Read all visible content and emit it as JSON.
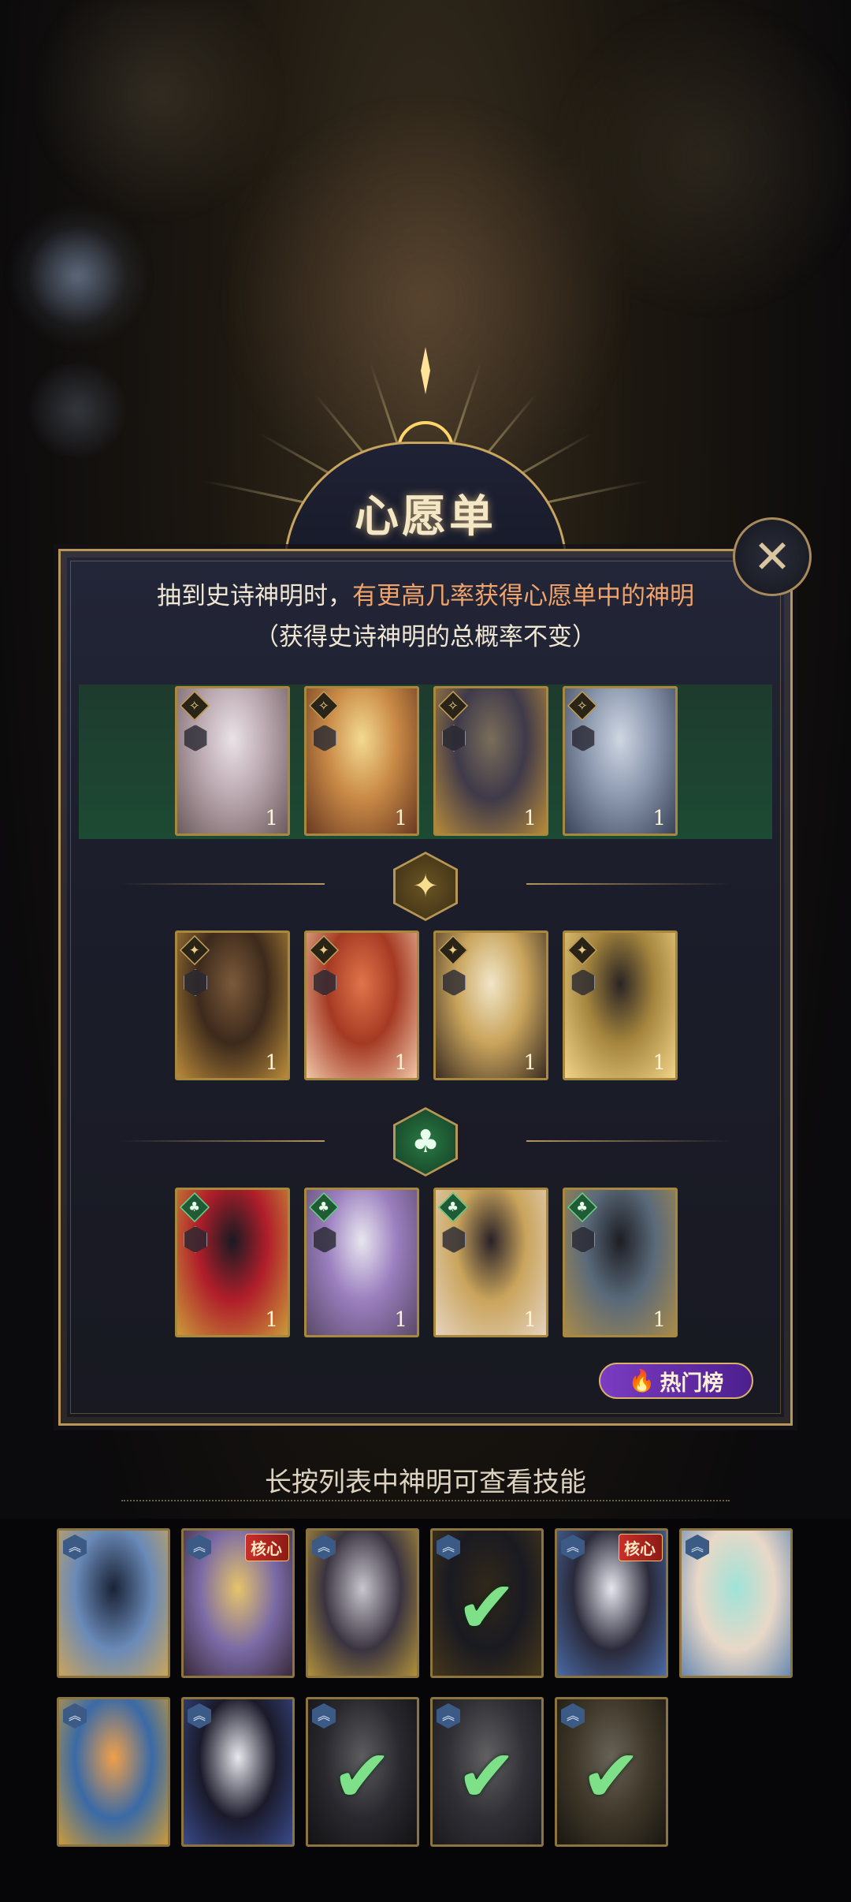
{
  "wishlist": {
    "title": "心愿单",
    "desc_prefix": "抽到史诗神明时，",
    "desc_highlight": "有更高几率获得心愿单中的神明",
    "desc_note": "（获得史诗神明的总概率不变）",
    "close_icon": "close-x-icon",
    "hot_list_label": "热门榜",
    "hot_list_icon": "flame-icon"
  },
  "rows": [
    {
      "group": "top",
      "cards": [
        {
          "count": "1",
          "palette": [
            "#e9e2e6",
            "#b9a7ae",
            "#6c5b5e"
          ]
        },
        {
          "count": "1",
          "palette": [
            "#f3d990",
            "#c98a46",
            "#6a3a22"
          ]
        },
        {
          "count": "1",
          "palette": [
            "#7a6e5a",
            "#3f3a4a",
            "#b78a3a"
          ]
        },
        {
          "count": "1",
          "palette": [
            "#cfd6e3",
            "#8a97ad",
            "#3b4459"
          ]
        }
      ]
    },
    {
      "group": "star",
      "divider_icon": "four-point-star-icon",
      "cards": [
        {
          "count": "1",
          "palette": [
            "#7b5a3a",
            "#3d2a1c",
            "#b98a3a"
          ]
        },
        {
          "count": "1",
          "palette": [
            "#e0744a",
            "#a53a24",
            "#f0c6a8"
          ]
        },
        {
          "count": "1",
          "palette": [
            "#f1e6c8",
            "#c9a45c",
            "#3a2c22"
          ]
        },
        {
          "count": "1",
          "palette": [
            "#2a2424",
            "#a6863e",
            "#f0d48a"
          ]
        }
      ]
    },
    {
      "group": "club",
      "divider_icon": "club-suit-icon",
      "cards": [
        {
          "count": "1",
          "palette": [
            "#1a1a22",
            "#b01e2a",
            "#c99a3a"
          ]
        },
        {
          "count": "1",
          "palette": [
            "#e8e6ef",
            "#9b7fbf",
            "#5a4a6a"
          ]
        },
        {
          "count": "1",
          "palette": [
            "#2a2228",
            "#c9a45c",
            "#e5d3c0"
          ]
        },
        {
          "count": "1",
          "palette": [
            "#1e1e24",
            "#5a6a7a",
            "#a88a4a"
          ]
        }
      ]
    }
  ],
  "hint": "长按列表中神明可查看技能",
  "picks": [
    [
      {
        "core": "",
        "selected": false,
        "palette": [
          "#1a2236",
          "#6a8ab8",
          "#c9a45c"
        ]
      },
      {
        "core": "核心",
        "selected": false,
        "palette": [
          "#e6c46a",
          "#7a6aa6",
          "#3a2a3a"
        ]
      },
      {
        "core": "",
        "selected": false,
        "palette": [
          "#c9c6cf",
          "#3a3440",
          "#b0903a"
        ]
      },
      {
        "core": "",
        "selected": true,
        "palette": [
          "#6a5a3a",
          "#3a3a4a",
          "#9a7a3a"
        ]
      },
      {
        "core": "核心",
        "selected": false,
        "palette": [
          "#e6e6ee",
          "#2a2a3a",
          "#4a6aa6"
        ]
      },
      {
        "core": "",
        "selected": false,
        "palette": [
          "#9fe3d8",
          "#e8d8c8",
          "#6a8ab0"
        ]
      }
    ],
    [
      {
        "core": "",
        "selected": false,
        "palette": [
          "#f0a04a",
          "#3a6aa6",
          "#c99a3a"
        ]
      },
      {
        "core": "",
        "selected": false,
        "palette": [
          "#e8e8ee",
          "#1a1a2a",
          "#3a4a8a"
        ]
      },
      {
        "core": "",
        "selected": true,
        "palette": [
          "#cfcfd6",
          "#5a5a66",
          "#2a2a30"
        ]
      },
      {
        "core": "",
        "selected": true,
        "palette": [
          "#d8d8de",
          "#6a6a76",
          "#3a3a44"
        ]
      },
      {
        "core": "",
        "selected": true,
        "palette": [
          "#e6d8c0",
          "#8a7a5a",
          "#3a3428"
        ]
      }
    ]
  ],
  "icons": {
    "rank_badge": "chevron-rank-icon",
    "selected": "check-icon",
    "weapon_type": "weapon-hex-icon"
  },
  "colors": {
    "accent_gold": "#c9a45c",
    "highlight_orange": "#f0a36b",
    "hot_purple": "#7b3cc2",
    "check_green": "#7fe08a"
  }
}
